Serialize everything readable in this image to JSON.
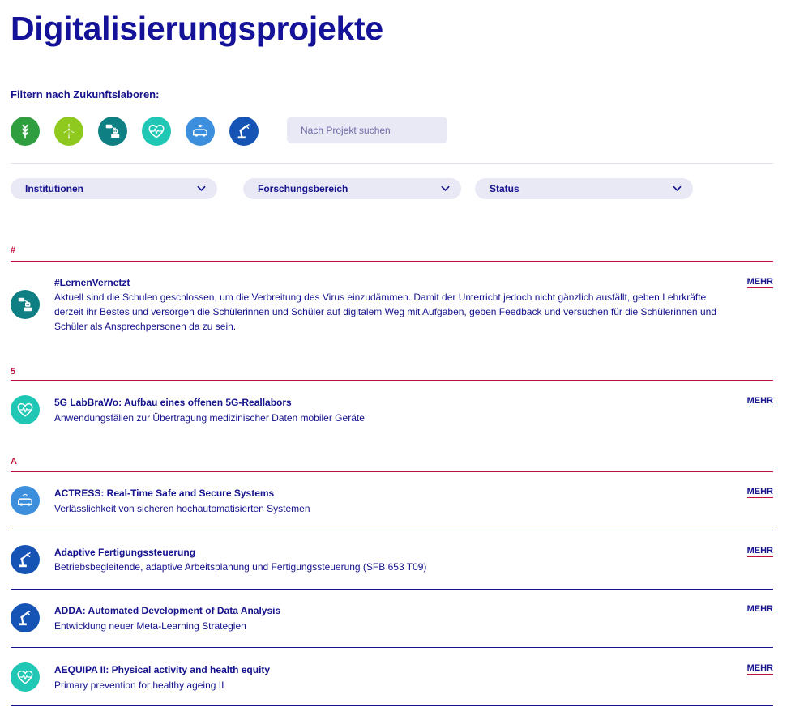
{
  "page": {
    "title": "Digitalisierungsprojekte",
    "filter_label": "Filtern nach Zukunftslaboren:",
    "search_placeholder": "Nach Projekt suchen"
  },
  "labs": [
    {
      "icon": "wheat-icon",
      "color": "#2f9e3f"
    },
    {
      "icon": "wind-turbine-icon",
      "color": "#8fc91f"
    },
    {
      "icon": "robot-teacher-icon",
      "color": "#0e7f82"
    },
    {
      "icon": "heart-pulse-icon",
      "color": "#1fc7b4"
    },
    {
      "icon": "connected-car-icon",
      "color": "#3b8fdc"
    },
    {
      "icon": "robot-arm-icon",
      "color": "#1554b5"
    }
  ],
  "filters": {
    "institutionen": "Institutionen",
    "forschungsbereich": "Forschungsbereich",
    "status": "Status"
  },
  "groups": {
    "hash": "#",
    "five": "5",
    "a": "A"
  },
  "more_label": "MEHR",
  "projects": [
    {
      "title": "#LernenVernetzt",
      "description": "Aktuell sind die Schulen geschlossen, um die Verbreitung des Virus einzudämmen. Damit der Unterricht jedoch nicht gänzlich ausfällt, geben Lehrkräfte derzeit ihr Bestes und versorgen die Schülerinnen und Schüler auf digitalem Weg mit Aufgaben, geben Feedback und versuchen für die Schülerinnen und Schüler als Ansprechpersonen da zu sein.",
      "icon": "robot-teacher-icon",
      "color": "#0e7f82"
    },
    {
      "title": "5G LabBraWo: Aufbau eines offenen 5G-Reallabors",
      "description": "Anwendungsfällen zur Übertragung medizinischer Daten mobiler Geräte",
      "icon": "heart-pulse-icon",
      "color": "#1fc7b4"
    },
    {
      "title": "ACTRESS: Real-Time Safe and Secure Systems",
      "description": "Verlässlichkeit von sicheren hochautomatisierten Systemen",
      "icon": "connected-car-icon",
      "color": "#3b8fdc"
    },
    {
      "title": "Adaptive Fertigungssteuerung",
      "description": "Betriebsbegleitende, adaptive Arbeitsplanung und Fertigungssteuerung (SFB 653 T09)",
      "icon": "robot-arm-icon",
      "color": "#1554b5"
    },
    {
      "title": "ADDA: Automated Development of Data Analysis",
      "description": "Entwicklung neuer Meta-Learning Strategien",
      "icon": "robot-arm-icon",
      "color": "#1554b5"
    },
    {
      "title": "AEQUIPA II: Physical activity and health equity",
      "description": "Primary prevention for healthy ageing II",
      "icon": "heart-pulse-icon",
      "color": "#1fc7b4"
    }
  ],
  "colors": {
    "primary": "#14128c",
    "accent": "#c20e3a",
    "input_bg": "#e9e8f5"
  }
}
